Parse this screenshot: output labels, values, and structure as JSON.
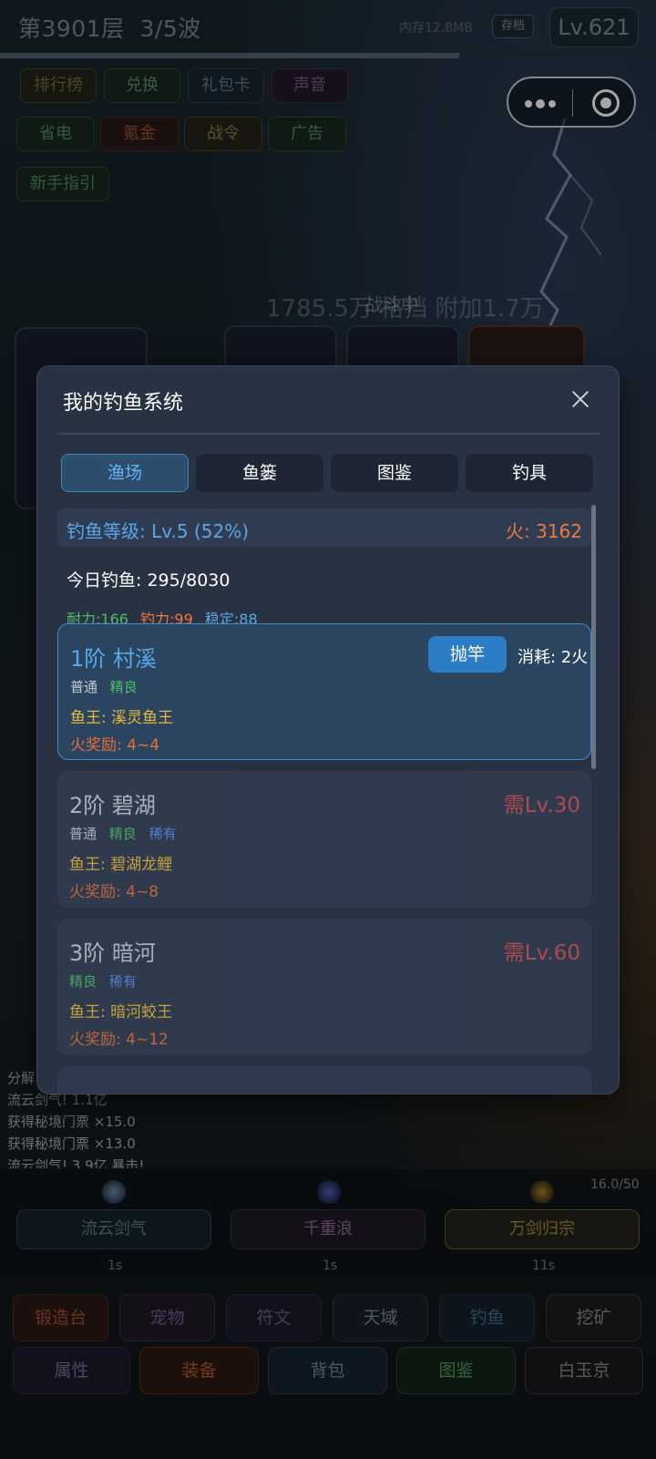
{
  "header": {
    "floor": "第3901层",
    "wave": "3/5波",
    "memory": "内存12.8MB",
    "save_label": "存档",
    "level": "Lv.621",
    "progress": 0.7
  },
  "quick_buttons": [
    "排行榜",
    "兑换",
    "礼包卡",
    "声音",
    "省电",
    "氪金",
    "战令",
    "广告",
    "新手指引"
  ],
  "battle": {
    "status": "战斗中",
    "damage_text": "1785.5万 格挡 附加1.7万"
  },
  "combat_log": [
    "分解",
    "流云剑气! 1.1亿",
    "获得秘境门票 ×15.0",
    "获得秘境门票 ×13.0",
    "流云剑气! 3.9亿 暴击!"
  ],
  "skills": {
    "counter": "16.0/50",
    "items": [
      {
        "label": "流云剑气",
        "cooldown": "1s",
        "icon": "sword-wind-icon"
      },
      {
        "label": "千重浪",
        "cooldown": "1s",
        "icon": "wave-icon"
      },
      {
        "label": "万剑归宗",
        "cooldown": "11s",
        "icon": "sword-sun-icon"
      }
    ]
  },
  "bottom_nav": {
    "row1": [
      "锻造台",
      "宠物",
      "符文",
      "天域",
      "钓鱼",
      "挖矿"
    ],
    "row2": [
      "属性",
      "装备",
      "背包",
      "图鉴",
      "白玉京"
    ]
  },
  "modal": {
    "title": "我的钓鱼系统",
    "tabs": [
      {
        "label": "渔场",
        "active": true
      },
      {
        "label": "鱼篓",
        "active": false
      },
      {
        "label": "图鉴",
        "active": false
      },
      {
        "label": "钓具",
        "active": false
      }
    ],
    "fishing_level": "钓鱼等级: Lv.5 (52%)",
    "fire": "火: 3162",
    "today_catch": "今日钓鱼: 295/8030",
    "stats": {
      "stamina": "耐力:166",
      "power": "钓力:99",
      "stability": "稳定:88"
    },
    "spots": [
      {
        "name": "1阶 村溪",
        "rarities": [
          "普通",
          "精良"
        ],
        "king": "鱼王: 溪灵鱼王",
        "reward": "火奖励: 4~4",
        "action_label": "抛竿",
        "cost": "消耗: 2火",
        "requirement": ""
      },
      {
        "name": "2阶 碧湖",
        "rarities": [
          "普通",
          "精良",
          "稀有"
        ],
        "king": "鱼王: 碧湖龙鲤",
        "reward": "火奖励: 4~8",
        "action_label": "",
        "cost": "",
        "requirement": "需Lv.30"
      },
      {
        "name": "3阶 暗河",
        "rarities": [
          "精良",
          "稀有"
        ],
        "king": "鱼王: 暗河蛟王",
        "reward": "火奖励: 4~12",
        "action_label": "",
        "cost": "",
        "requirement": "需Lv.60"
      }
    ]
  },
  "colors": {
    "accent": "#58a8ea",
    "fire": "#f07a3c",
    "king": "#e8b93c",
    "rarity_common": "#c6ccd4",
    "rarity_fine": "#4fbf6a",
    "rarity_rare": "#5a8ee8",
    "requirement": "#cc5050"
  }
}
